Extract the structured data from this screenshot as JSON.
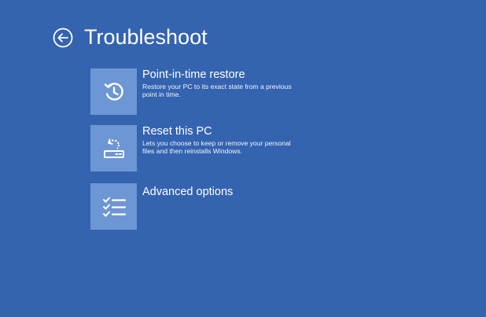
{
  "header": {
    "title": "Troubleshoot",
    "back_icon": "arrow-left-circle-icon"
  },
  "options": [
    {
      "title": "Point-in-time restore",
      "description": "Restore your PC to its exact state from a previous point in time.",
      "icon": "history-clock-icon"
    },
    {
      "title": "Reset this PC",
      "description": "Lets you choose to keep or remove your personal files and then reinstalls Windows.",
      "icon": "reset-pc-icon"
    },
    {
      "title": "Advanced options",
      "description": "",
      "icon": "checklist-icon"
    }
  ],
  "colors": {
    "background": "#3463b0",
    "tile": "#6d96d4",
    "text": "#ffffff"
  }
}
